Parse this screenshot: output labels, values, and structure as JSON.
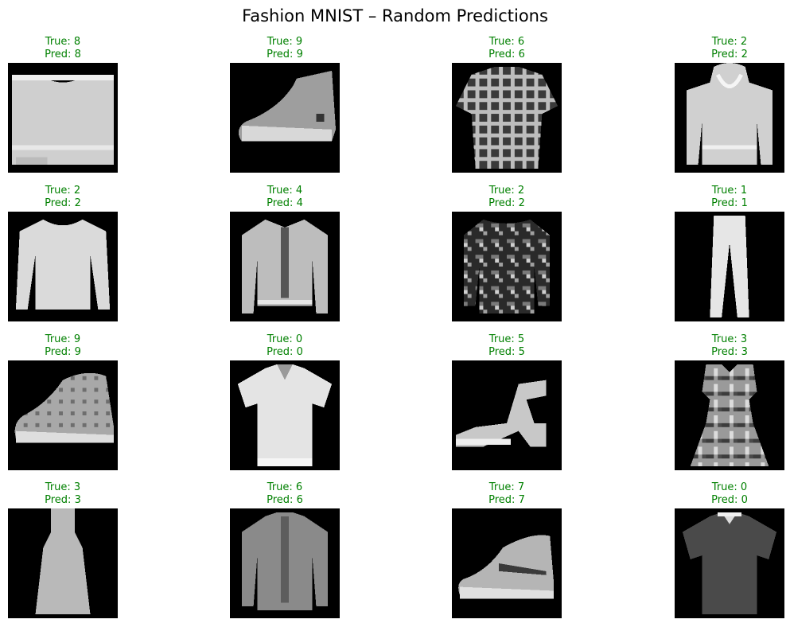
{
  "figure": {
    "title": "Fashion MNIST – Random Predictions"
  },
  "colors": {
    "correct_label": "#008000",
    "image_background": "#000000"
  },
  "chart_data": {
    "type": "image_grid",
    "title": "Fashion MNIST – Random Predictions",
    "rows": 4,
    "cols": 4,
    "colormap": "gray",
    "panels": [
      {
        "true_label": "True: 8",
        "pred_label": "Pred: 8",
        "true": 8,
        "pred": 8,
        "item": "bag"
      },
      {
        "true_label": "True: 9",
        "pred_label": "Pred: 9",
        "true": 9,
        "pred": 9,
        "item": "ankle-boot"
      },
      {
        "true_label": "True: 6",
        "pred_label": "Pred: 6",
        "true": 6,
        "pred": 6,
        "item": "checked-shirt"
      },
      {
        "true_label": "True: 2",
        "pred_label": "Pred: 2",
        "true": 2,
        "pred": 2,
        "item": "hoodie"
      },
      {
        "true_label": "True: 2",
        "pred_label": "Pred: 2",
        "true": 2,
        "pred": 2,
        "item": "sweater"
      },
      {
        "true_label": "True: 4",
        "pred_label": "Pred: 4",
        "true": 4,
        "pred": 4,
        "item": "coat"
      },
      {
        "true_label": "True: 2",
        "pred_label": "Pred: 2",
        "true": 2,
        "pred": 2,
        "item": "dark-patterned-pullover"
      },
      {
        "true_label": "True: 1",
        "pred_label": "Pred: 1",
        "true": 1,
        "pred": 1,
        "item": "trouser"
      },
      {
        "true_label": "True: 9",
        "pred_label": "Pred: 9",
        "true": 9,
        "pred": 9,
        "item": "sneaker-boot"
      },
      {
        "true_label": "True: 0",
        "pred_label": "Pred: 0",
        "true": 0,
        "pred": 0,
        "item": "polo-shirt"
      },
      {
        "true_label": "True: 5",
        "pred_label": "Pred: 5",
        "true": 5,
        "pred": 5,
        "item": "sandal"
      },
      {
        "true_label": "True: 3",
        "pred_label": "Pred: 3",
        "true": 3,
        "pred": 3,
        "item": "dress"
      },
      {
        "true_label": "True: 3",
        "pred_label": "Pred: 3",
        "true": 3,
        "pred": 3,
        "item": "long-dress"
      },
      {
        "true_label": "True: 6",
        "pred_label": "Pred: 6",
        "true": 6,
        "pred": 6,
        "item": "long-sleeve-shirt"
      },
      {
        "true_label": "True: 7",
        "pred_label": "Pred: 7",
        "true": 7,
        "pred": 7,
        "item": "sneaker"
      },
      {
        "true_label": "True: 0",
        "pred_label": "Pred: 0",
        "true": 0,
        "pred": 0,
        "item": "dark-polo"
      }
    ]
  }
}
